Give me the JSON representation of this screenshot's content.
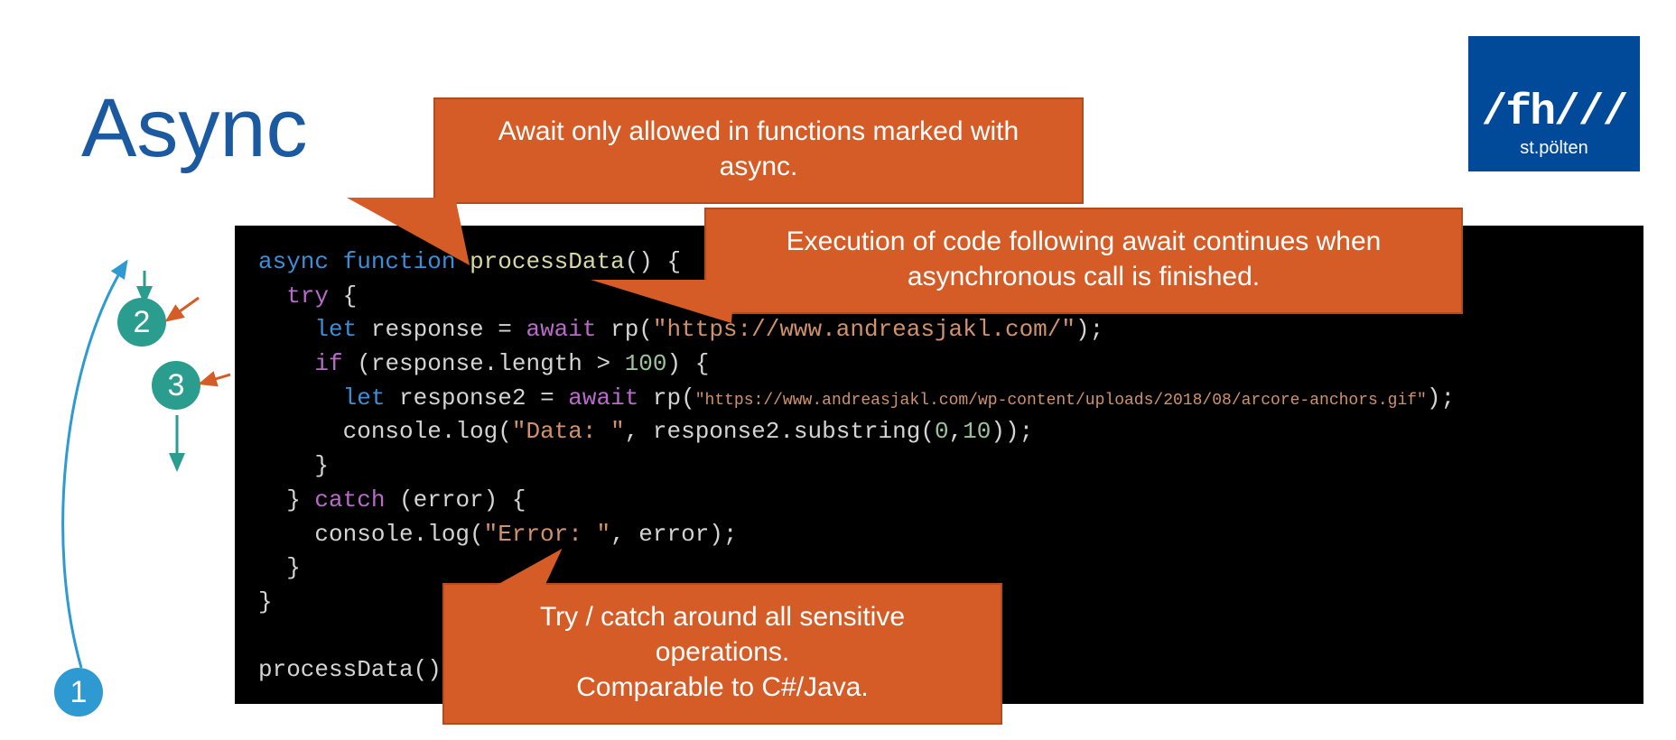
{
  "title": "Async",
  "logo": {
    "main": "/fh///",
    "sub": "st.pölten"
  },
  "callouts": {
    "top": "Await only allowed in functions marked with async.",
    "right": "Execution of code following await continues when asynchronous call is finished.",
    "bottom_line1": "Try / catch around all sensitive operations.",
    "bottom_line2": "Comparable to C#/Java."
  },
  "steps": {
    "one": "1",
    "two": "2",
    "three": "3"
  },
  "code": {
    "l1_async": "async",
    "l1_function": "function",
    "l1_name": "processData",
    "l1_paren": "() {",
    "l2_try": "try",
    "l2_brace": " {",
    "l3_let": "let",
    "l3_var": " response = ",
    "l3_await": "await",
    "l3_rp": " rp(",
    "l3_url": "\"https://www.andreasjakl.com/\"",
    "l3_close": ");",
    "l4_if": "if",
    "l4_cond_pre": " (response.length > ",
    "l4_num": "100",
    "l4_cond_post": ") {",
    "l5_let": "let",
    "l5_var": " response2 = ",
    "l5_await": "await",
    "l5_rp": " rp(",
    "l5_url": "\"https://www.andreasjakl.com/wp-content/uploads/2018/08/arcore-anchors.gif\"",
    "l5_close": ");",
    "l6_pre": "      console.log(",
    "l6_str": "\"Data: \"",
    "l6_mid": ", response2.substring(",
    "l6_n1": "0",
    "l6_comma": ",",
    "l6_n2": "10",
    "l6_end": "));",
    "l7": "    }",
    "l8_close": "  } ",
    "l8_catch": "catch",
    "l8_arg": " (error) {",
    "l9_pre": "    console.log(",
    "l9_str": "\"Error: \"",
    "l9_post": ", error);",
    "l10": "  }",
    "l11": "}",
    "l12_call": "processData();"
  }
}
